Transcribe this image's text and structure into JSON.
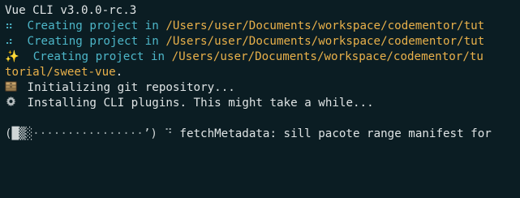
{
  "terminal": {
    "colors": {
      "background": "#0b1d23",
      "text": "#dfe4e5",
      "path": "#e8b04a",
      "accent": "#4db6c8"
    },
    "header": "Vue CLI v3.0.0-rc.3",
    "creating_lines": [
      {
        "icon": "spinner-dots-icon",
        "prefix": "⠶ ",
        "text": " Creating project in ",
        "path": "/Users/user/Documents/workspace/codementor/tut"
      },
      {
        "icon": "spinner-dots-icon",
        "prefix": "⠴ ",
        "text": " Creating project in ",
        "path": "/Users/user/Documents/workspace/codementor/tut"
      }
    ],
    "sparkle_line": {
      "icon": "sparkles-icon",
      "symbol": "✨",
      "text": "  Creating project in ",
      "path_part1": "/Users/user/Documents/workspace/codementor/tu",
      "path_part2": "torial/sweet-vue",
      "suffix": "."
    },
    "git_line": {
      "icon": "file-cabinet-icon",
      "text": " Initializing git repository..."
    },
    "plugins_line": {
      "icon": "gear-icon",
      "text": " Installing CLI plugins. This might take a while..."
    },
    "progress_line": {
      "spinner_left": "(█▒░",
      "dots": "················",
      "spinner_right": "’) ",
      "status_icon": "⠙",
      "status_text": " fetchMetadata: sill pacote range manifest for"
    }
  }
}
